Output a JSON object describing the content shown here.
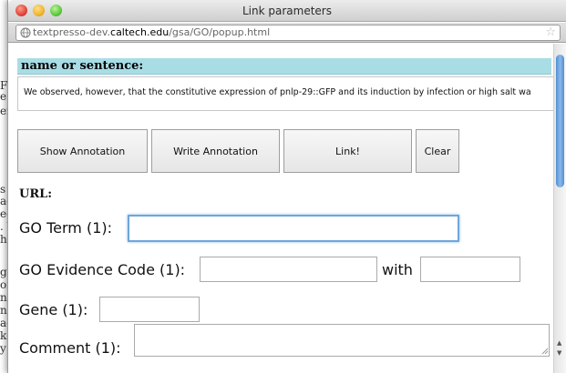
{
  "background_text": [
    "FP",
    "e",
    "er",
    "",
    "",
    "",
    "",
    "",
    "",
    "s ir",
    "ag",
    "ed",
    ". V",
    "he",
    "",
    "g f",
    "of",
    "ndi",
    "n o",
    "ad",
    "kes",
    "y r"
  ],
  "window": {
    "title": "Link parameters",
    "url": {
      "prefix": "textpresso-dev.",
      "host": "caltech.edu",
      "path": "/gsa/GO/popup.html"
    }
  },
  "section": {
    "header": "name or sentence:",
    "sentence": "We observed, however, that the constitutive expression of pnlp-29::GFP and its induction by infection or high salt wa"
  },
  "buttons": {
    "show_annotation": "Show Annotation",
    "write_annotation": "Write Annotation",
    "link": "Link!",
    "clear": "Clear"
  },
  "url_label": "URL:",
  "fields": {
    "go_term": {
      "label": "GO Term (1):",
      "value": ""
    },
    "evidence": {
      "label": "GO Evidence Code (1):",
      "value": "",
      "with_label": "with",
      "with_value": ""
    },
    "gene": {
      "label": "Gene (1):",
      "value": ""
    },
    "comment": {
      "label": "Comment (1):",
      "value": ""
    }
  }
}
